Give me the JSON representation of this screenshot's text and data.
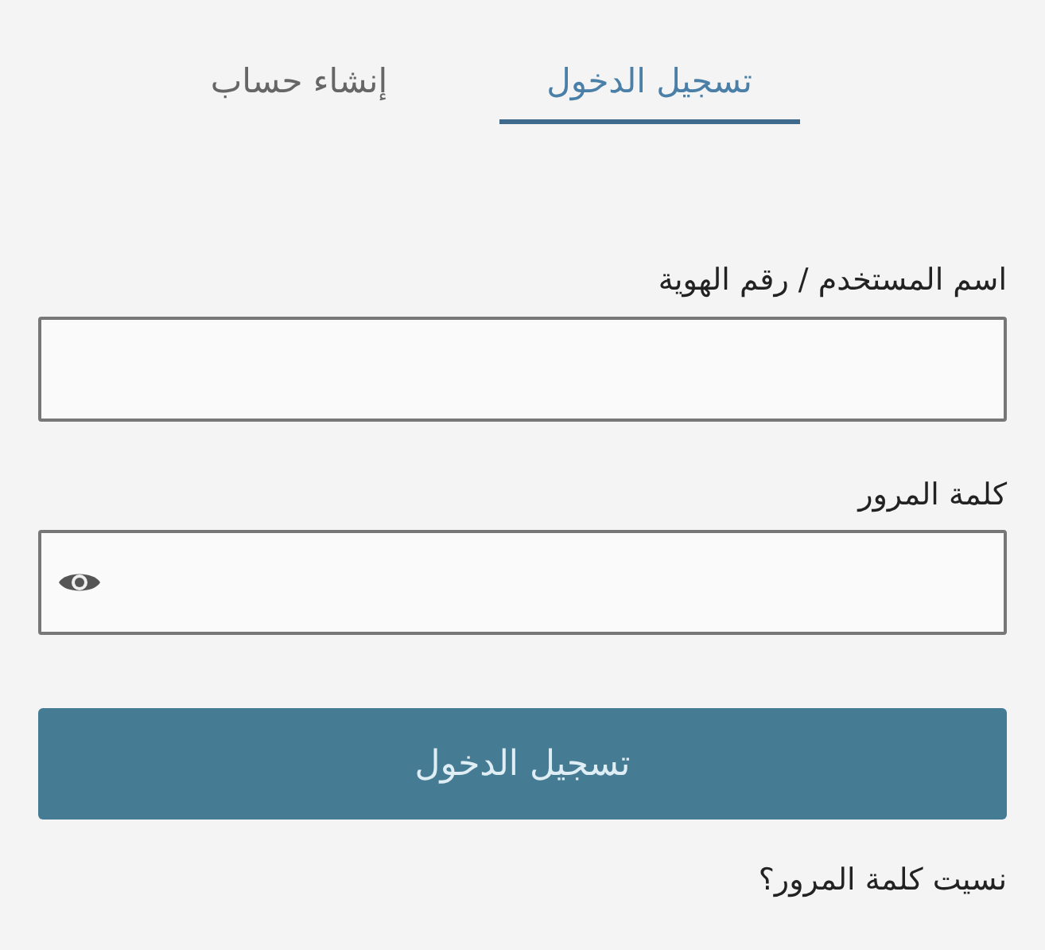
{
  "tabs": [
    {
      "label": "تسجيل الدخول",
      "selected": true
    },
    {
      "label": "إنشاء حساب",
      "selected": false
    }
  ],
  "fields": [
    {
      "label": "اسم المستخدم / رقم الهوية",
      "kind": "text"
    },
    {
      "label": "كلمة المرور",
      "kind": "password"
    }
  ],
  "submit": "تسجيل الدخول",
  "forgot_link": "نسيت كلمة المرور؟"
}
